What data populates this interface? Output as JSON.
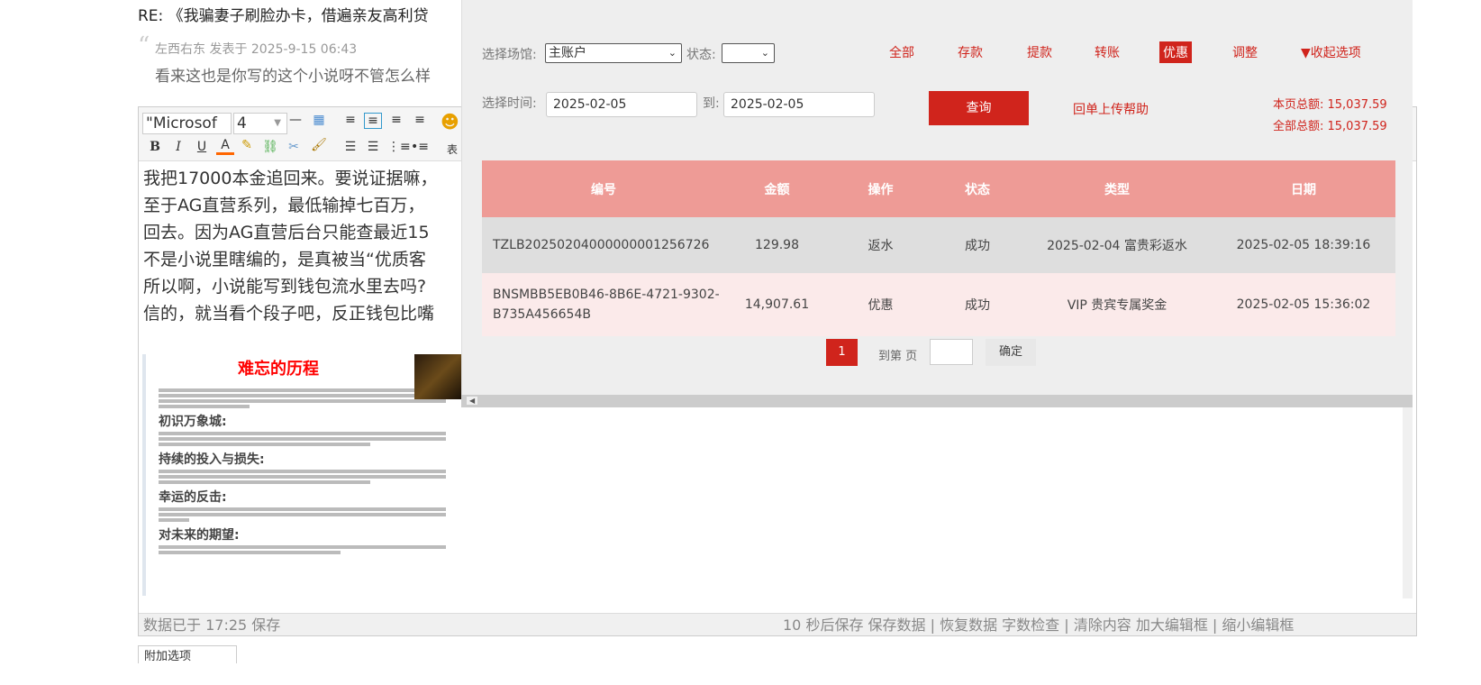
{
  "post": {
    "title": "RE: 《我骗妻子刷脸办卡，借遍亲友高利贷",
    "quote_meta": "左西右东 发表于 2025-9-15 06:43",
    "quote_text": "看来这也是你写的这个小说呀不管怎么样"
  },
  "editor": {
    "font": "\"Microsof",
    "size": "4",
    "lines": [
      "我把17000本金追回来。要说证据嘛，",
      "至于AG直营系列，最低输掉七百万，",
      "回去。因为AG直营后台只能查最近15",
      "不是小说里瞎编的，是真被当“优质客",
      "所以啊，小说能写到钱包流水里去吗?",
      "信的，就当看个段子吧，反正钱包比嘴"
    ],
    "image": {
      "title": "难忘的历程",
      "h1": "初识万象城:",
      "h2": "持续的投入与损失:",
      "h3": "幸运的反击:",
      "h4": "对未来的期望:"
    },
    "status_left": "数据已于 17:25 保存",
    "status_right": "10 秒后保存 保存数据 | 恢复数据    字数检查 | 清除内容    加大编辑框 | 缩小编辑框"
  },
  "bottom_button": "附加选项",
  "popup": {
    "venue_label": "选择场馆:",
    "venue_value": "主账户",
    "status_label": "状态:",
    "status_value": "",
    "filters": [
      "全部",
      "存款",
      "提款",
      "转账",
      "优惠",
      "调整"
    ],
    "active_filter": "优惠",
    "collapse": "▼收起选项",
    "time_label": "选择时间:",
    "date_from": "2025-02-05",
    "to_label": "到:",
    "date_to": "2025-02-05",
    "query": "查询",
    "help": "回单上传帮助",
    "page_total": "本页总额: 15,037.59",
    "all_total": "全部总额: 15,037.59",
    "columns": [
      "编号",
      "金额",
      "操作",
      "状态",
      "类型",
      "日期"
    ],
    "rows": [
      [
        "TZLB20250204000000001256726",
        "129.98",
        "返水",
        "成功",
        "2025-02-04 富贵彩返水",
        "2025-02-05 18:39:16"
      ],
      [
        "BNSMBB5EB0B46-8B6E-4721-9302-B735A456654B",
        "14,907.61",
        "优惠",
        "成功",
        "VIP 贵宾专属奖金",
        "2025-02-05 15:36:02"
      ]
    ],
    "page": "1",
    "goto_label": "到第 页",
    "goto_value": "",
    "confirm": "确定"
  },
  "colors": {
    "accent": "#d0241c",
    "header": "#ee9b96"
  }
}
